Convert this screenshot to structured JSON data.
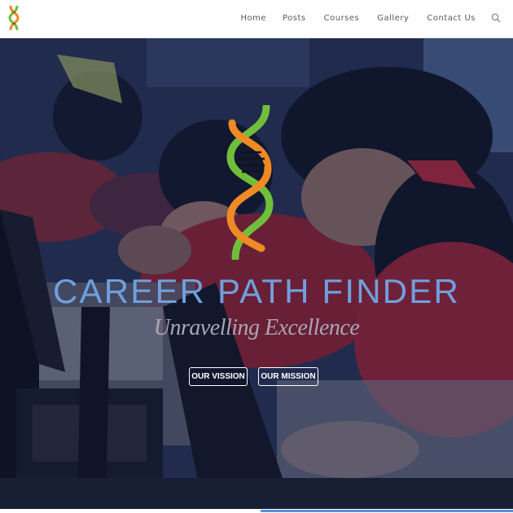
{
  "header": {
    "logo_icon": "dna-helix-logo",
    "nav": [
      {
        "label": "Home"
      },
      {
        "label": "Posts"
      },
      {
        "label": "Courses"
      },
      {
        "label": "Gallery"
      },
      {
        "label": "Contact Us"
      }
    ],
    "search_icon": "search-icon"
  },
  "hero": {
    "logo_icon": "dna-helix-logo",
    "title": "CAREER PATH FINDER",
    "tagline": "Unravelling Excellence",
    "buttons": [
      {
        "label": "OUR VISSION"
      },
      {
        "label": "OUR MISSION"
      }
    ]
  },
  "colors": {
    "title": "#6fa0dd",
    "logo_orange": "#f08a24",
    "logo_green": "#6fbf3a",
    "overlay": "#1c2a5a",
    "nav_text": "#5a5a5a"
  }
}
